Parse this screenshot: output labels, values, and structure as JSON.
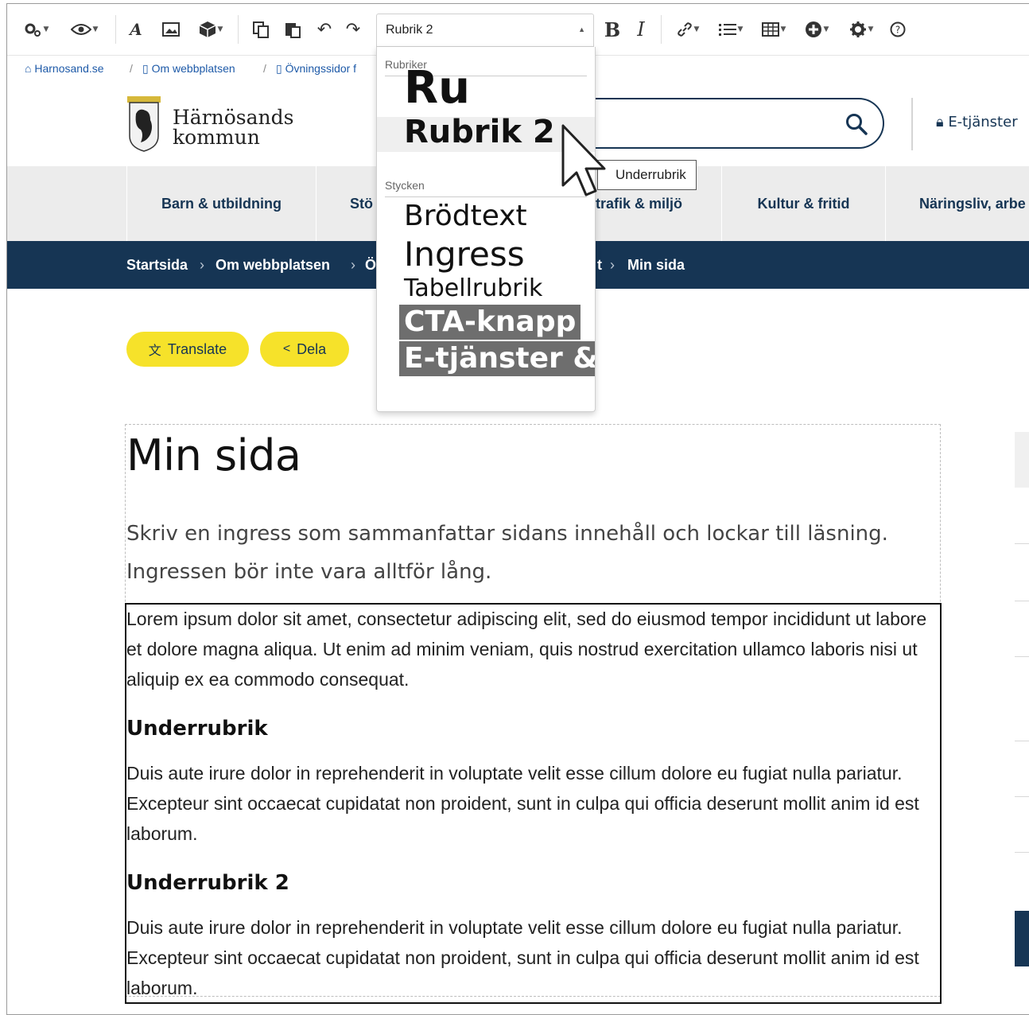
{
  "toolbar": {
    "format_select": {
      "value": "Rubrik 2"
    },
    "buttons": [
      "settings",
      "preview",
      "font",
      "image",
      "block",
      "paste-text",
      "paste-word",
      "undo",
      "redo",
      "bold",
      "italic",
      "link",
      "list",
      "table",
      "insert",
      "config",
      "help"
    ],
    "bold_label": "B",
    "italic_label": "I"
  },
  "pathbar": {
    "items": [
      "Harnosand.se",
      "Om webbplatsen",
      "Övningssidor f"
    ]
  },
  "header": {
    "logo_line1": "Härnösands",
    "logo_line2": "kommun",
    "eservices_label": "E-tjänster"
  },
  "nav": {
    "items": [
      "Barn & utbildning",
      "Stö",
      "trafik & miljö",
      "Kultur & fritid",
      "Näringsliv, arbe"
    ]
  },
  "breadcrumb": {
    "items": [
      "Startsida",
      "Om webbplatsen",
      "Ö",
      "t",
      "Min sida"
    ]
  },
  "actions": {
    "translate_label": "Translate",
    "share_label": "Dela"
  },
  "content": {
    "title": "Min sida",
    "ingress": "Skriv en ingress som sammanfattar sidans innehåll och lockar till läsning. Ingressen bör inte vara alltför lång.",
    "p1": "Lorem ipsum dolor sit amet, consectetur adipiscing elit, sed do eiusmod tempor incididunt ut labore et dolore magna aliqua. Ut enim ad minim veniam, quis nostrud exercitation ullamco laboris nisi ut aliquip ex ea commodo consequat.",
    "h2a": "Underrubrik",
    "p2": "Duis aute irure dolor in reprehenderit in voluptate velit esse cillum dolore eu fugiat nulla pariatur. Excepteur sint occaecat cupidatat non proident, sunt in culpa qui officia deserunt mollit anim id est laborum.",
    "h2b": "Underrubrik 2",
    "p3": "Duis aute irure dolor in reprehenderit in voluptate velit esse cillum dolore eu fugiat nulla pariatur. Excepteur sint occaecat cupidatat non proident, sunt in culpa qui officia deserunt mollit anim id est laborum."
  },
  "dropdown": {
    "group_headings": "Rubriker",
    "opt_cut": "Ru",
    "opt_heading2": "Rubrik 2",
    "group_paragraphs": "Stycken",
    "opt_body": "Brödtext",
    "opt_ingress": "Ingress",
    "opt_tableheading": "Tabellrubrik",
    "opt_cta": "CTA-knapp",
    "opt_eservice": "E-tjänster &"
  },
  "tooltip": "Underrubrik",
  "colors": {
    "brand_navy": "#163554",
    "button_yellow": "#f6e22a",
    "nav_bg": "#ececec"
  }
}
